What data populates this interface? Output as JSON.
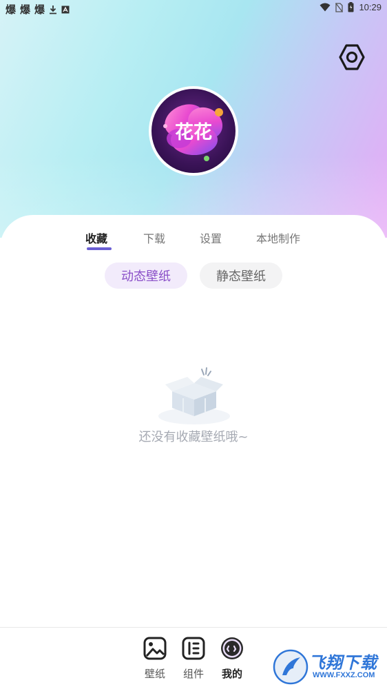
{
  "status_bar": {
    "left_glyphs": [
      "爆",
      "爆",
      "爆"
    ],
    "time": "10:29"
  },
  "header": {
    "avatar_text": "花花"
  },
  "tabs": [
    {
      "label": "收藏",
      "active": true
    },
    {
      "label": "下载",
      "active": false
    },
    {
      "label": "设置",
      "active": false
    },
    {
      "label": "本地制作",
      "active": false
    }
  ],
  "filters": [
    {
      "label": "动态壁纸",
      "active": true
    },
    {
      "label": "静态壁纸",
      "active": false
    }
  ],
  "empty_state": {
    "message": "还没有收藏壁纸哦~"
  },
  "bottom_nav": [
    {
      "label": "壁纸",
      "icon": "image-icon",
      "active": false
    },
    {
      "label": "组件",
      "icon": "widget-icon",
      "active": false
    },
    {
      "label": "我的",
      "icon": "profile-face-icon",
      "active": true
    }
  ],
  "watermark": {
    "text": "飞翔下载",
    "url": "WWW.FXXZ.COM"
  },
  "colors": {
    "accent": "#6a5ed3",
    "chip_active_bg": "#f2ebfb",
    "chip_active_text": "#8a4fc8",
    "empty_text": "#a6aab3"
  }
}
